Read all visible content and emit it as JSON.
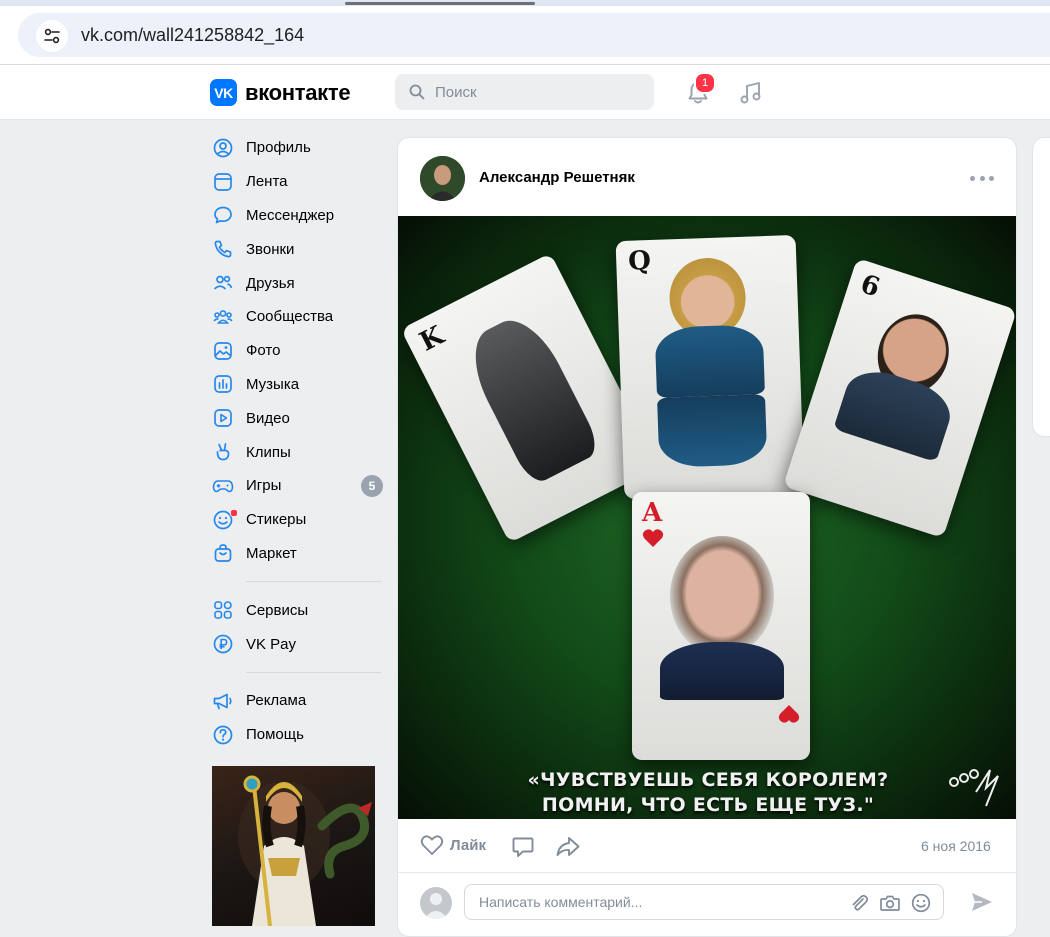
{
  "browser": {
    "url": "vk.com/wall241258842_164"
  },
  "header": {
    "logo_badge": "VK",
    "logo_text": "вконтакте",
    "search_placeholder": "Поиск",
    "notifications_count": "1"
  },
  "sidebar": {
    "items": [
      {
        "label": "Профиль",
        "icon": "profile-icon"
      },
      {
        "label": "Лента",
        "icon": "feed-icon"
      },
      {
        "label": "Мессенджер",
        "icon": "messenger-icon"
      },
      {
        "label": "Звонки",
        "icon": "phone-icon"
      },
      {
        "label": "Друзья",
        "icon": "friends-icon"
      },
      {
        "label": "Сообщества",
        "icon": "communities-icon"
      },
      {
        "label": "Фото",
        "icon": "photo-icon"
      },
      {
        "label": "Музыка",
        "icon": "music-icon"
      },
      {
        "label": "Видео",
        "icon": "video-icon"
      },
      {
        "label": "Клипы",
        "icon": "clips-icon"
      },
      {
        "label": "Игры",
        "icon": "games-icon",
        "count": "5"
      },
      {
        "label": "Стикеры",
        "icon": "stickers-icon"
      },
      {
        "label": "Маркет",
        "icon": "market-icon"
      }
    ],
    "items2": [
      {
        "label": "Сервисы",
        "icon": "services-icon"
      },
      {
        "label": "VK Pay",
        "icon": "vkpay-icon"
      }
    ],
    "items3": [
      {
        "label": "Реклама",
        "icon": "ads-icon"
      },
      {
        "label": "Помощь",
        "icon": "help-icon"
      }
    ]
  },
  "post": {
    "author": "Александр Решетняк",
    "image_caption_line1": "«ЧУВСТВУЕШЬ СЕБЯ КОРОЛЕМ?",
    "image_caption_line2": "ПОМНИ, ЧТО ЕСТЬ ЕЩЕ ТУЗ.\"",
    "cards": [
      "K",
      "Q",
      "6",
      "A"
    ],
    "like_label": "Лайк",
    "date": "6 ноя 2016",
    "comment_placeholder": "Написать комментарий..."
  },
  "colors": {
    "accent": "#0077ff",
    "icon": "#2688eb",
    "muted": "#818c99",
    "badge_red": "#ff3347"
  }
}
